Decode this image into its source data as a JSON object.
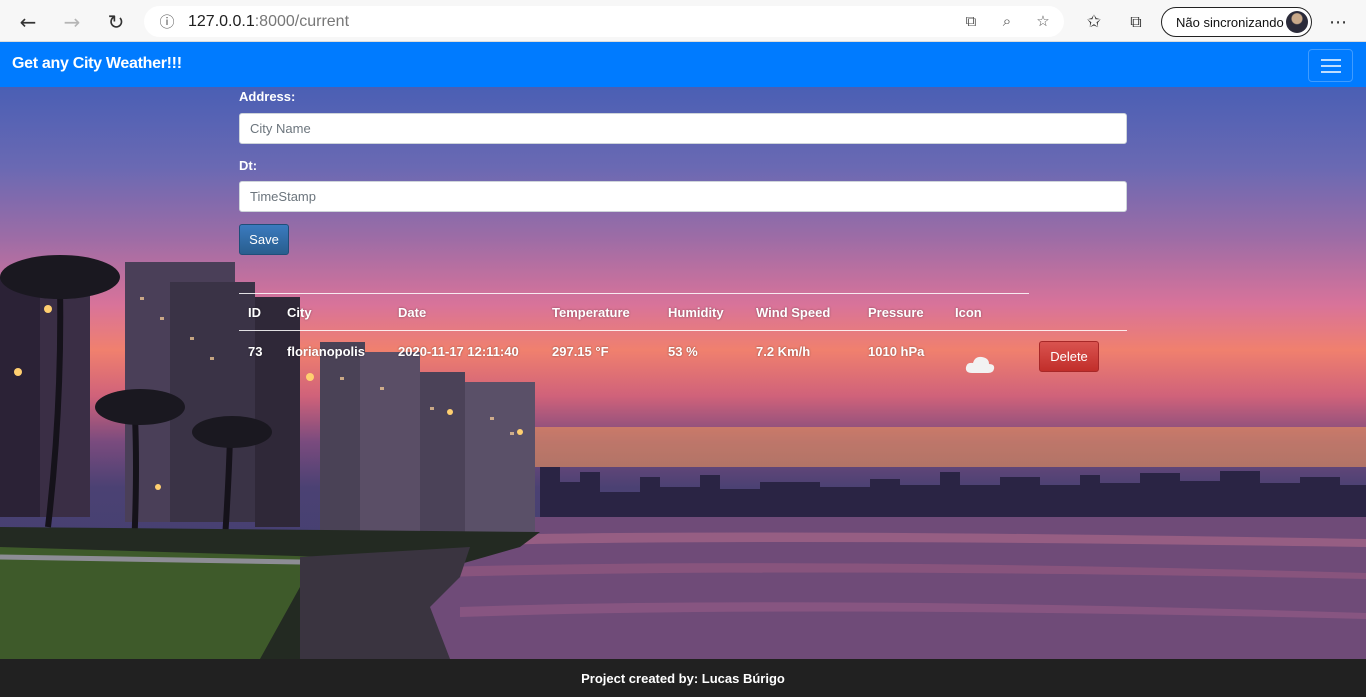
{
  "browser": {
    "url_host": "127.0.0.1",
    "url_rest": ":8000/current",
    "profile_label": "Não sincronizando"
  },
  "navbar": {
    "brand": "Get any City Weather!!!"
  },
  "form": {
    "address_label": "Address:",
    "address_placeholder": "City Name",
    "dt_label": "Dt:",
    "dt_placeholder": "TimeStamp",
    "save_label": "Save"
  },
  "table": {
    "headers": [
      "ID",
      "City",
      "Date",
      "Temperature",
      "Humidity",
      "Wind Speed",
      "Pressure",
      "Icon"
    ],
    "rows": [
      {
        "id": "73",
        "city": "florianopolis",
        "date": "2020-11-17 12:11:40",
        "temperature": "297.15 °F",
        "humidity": "53 %",
        "wind_speed": "7.2 Km/h",
        "pressure": "1010 hPa",
        "icon": "cloud-icon",
        "delete_label": "Delete"
      }
    ]
  },
  "footer": {
    "text": "Project created by: Lucas Búrigo"
  },
  "colors": {
    "navbar": "#007bff",
    "save_button": "#337ab7",
    "delete_button": "#d9534f",
    "footer": "#212121"
  }
}
